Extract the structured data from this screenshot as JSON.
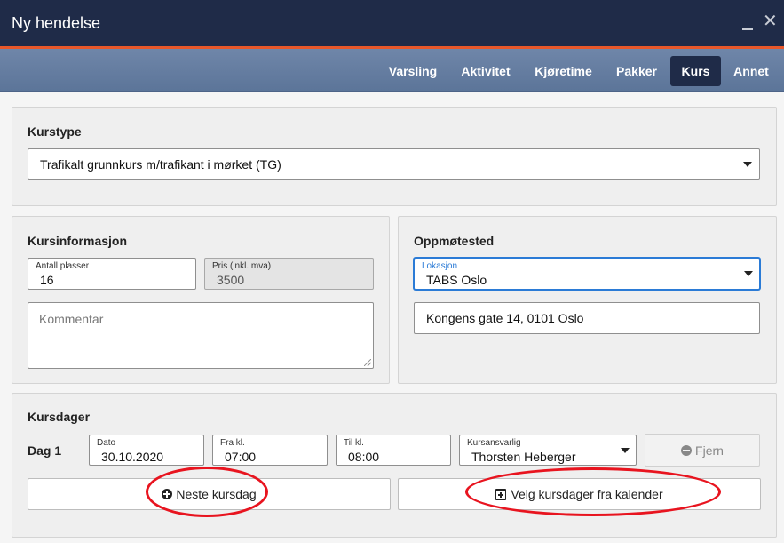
{
  "window": {
    "title": "Ny hendelse"
  },
  "tabs": [
    {
      "label": "Varsling",
      "active": false
    },
    {
      "label": "Aktivitet",
      "active": false
    },
    {
      "label": "Kjøretime",
      "active": false
    },
    {
      "label": "Pakker",
      "active": false
    },
    {
      "label": "Kurs",
      "active": true
    },
    {
      "label": "Annet",
      "active": false
    }
  ],
  "kurstype": {
    "title": "Kurstype",
    "selected": "Trafikalt grunnkurs m/trafikant i mørket (TG)"
  },
  "kursinformasjon": {
    "title": "Kursinformasjon",
    "antall_label": "Antall plasser",
    "antall_value": "16",
    "pris_label": "Pris (inkl. mva)",
    "pris_value": "3500",
    "kommentar_placeholder": "Kommentar"
  },
  "oppmotested": {
    "title": "Oppmøtested",
    "lokasjon_label": "Lokasjon",
    "lokasjon_value": "TABS Oslo",
    "address": "Kongens gate 14, 0101 Oslo"
  },
  "kursdager": {
    "title": "Kursdager",
    "day_label": "Dag 1",
    "dato_label": "Dato",
    "dato_value": "30.10.2020",
    "fra_label": "Fra kl.",
    "fra_value": "07:00",
    "til_label": "Til kl.",
    "til_value": "08:00",
    "ansvarlig_label": "Kursansvarlig",
    "ansvarlig_value": "Thorsten Heberger",
    "remove_label": "Fjern",
    "next_day_label": "Neste kursdag",
    "calendar_label": "Velg kursdager fra kalender"
  },
  "colors": {
    "titlebar": "#1f2b48",
    "accent": "#e8572a",
    "nav": "#5c7599",
    "highlight": "#e8141f"
  },
  "icons": {
    "next_day": "plus-circle-icon",
    "remove": "minus-circle-icon",
    "calendar": "calendar-plus-icon",
    "dropdown": "caret-down-icon"
  }
}
